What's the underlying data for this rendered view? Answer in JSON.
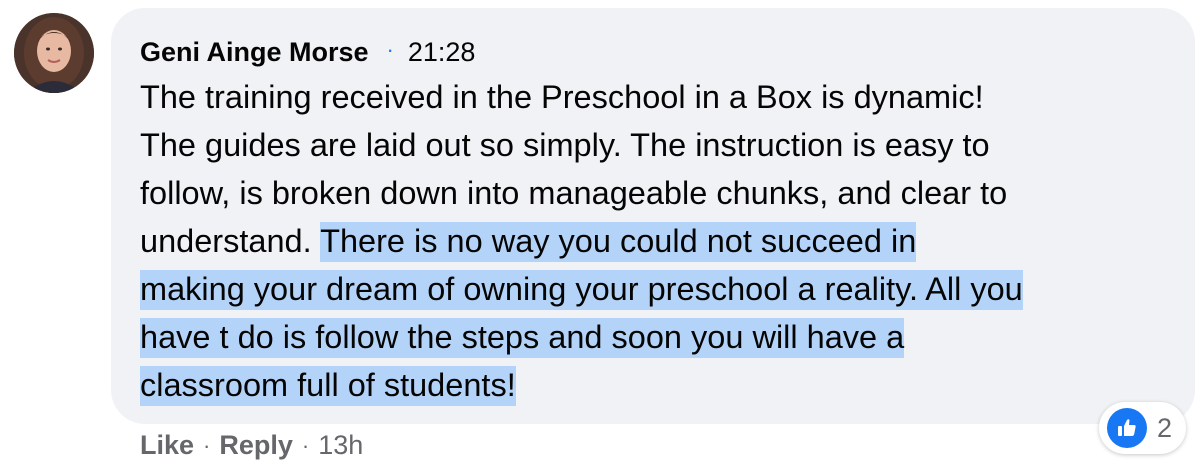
{
  "comment": {
    "author": "Geni Ainge Morse",
    "separator_dot": "·",
    "time": "21:28",
    "text_lines": [
      "The training received in the Preschool in a Box is dynamic!",
      "The guides are laid out so simply. The instruction is easy to",
      "follow, is broken down into manageable chunks, and clear to",
      "understand. ",
      "There is no way you could not succeed in",
      "making your dream of owning your preschool a reality. All you",
      "have t do is follow the steps and soon you will have a",
      "classroom full of students!"
    ],
    "highlighted_text_color": "#b4d3f8",
    "bubble_color": "#f0f2f5"
  },
  "actions": {
    "like_label": "Like",
    "sep1": "·",
    "reply_label": "Reply",
    "sep2": "·",
    "age": "13h"
  },
  "reactions": {
    "icon": "thumbs-up-icon",
    "count": "2",
    "color": "#1877f2"
  },
  "avatar": {
    "icon": "profile-photo"
  }
}
